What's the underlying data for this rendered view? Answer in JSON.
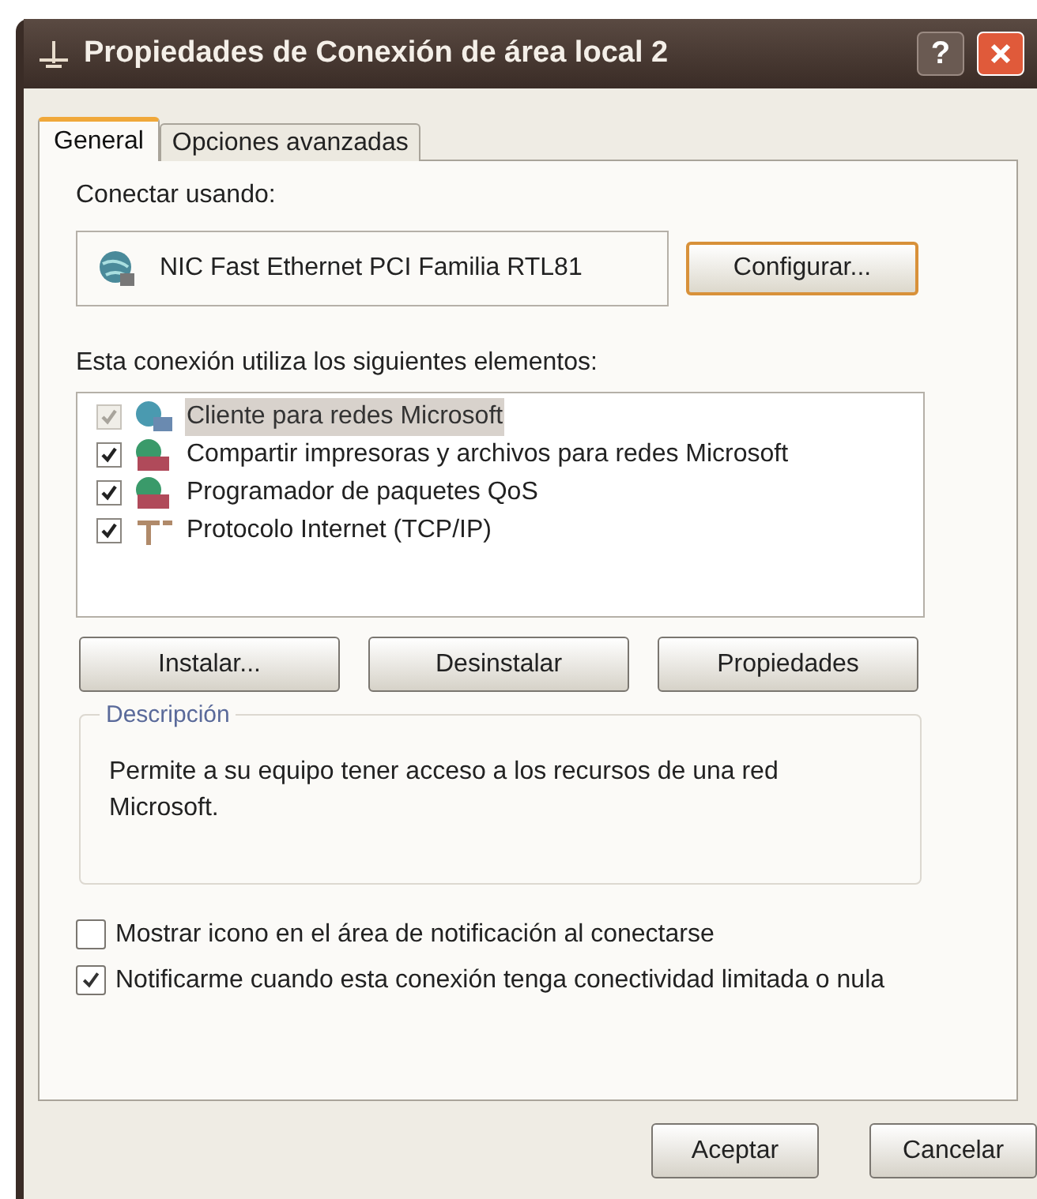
{
  "window": {
    "title": "Propiedades de Conexión de área local 2",
    "help_button": "?"
  },
  "tabs": [
    {
      "label": "General",
      "selected": true
    },
    {
      "label": "Opciones avanzadas",
      "selected": false
    }
  ],
  "connect_using": {
    "label": "Conectar usando:",
    "adapter": "NIC Fast Ethernet PCI Familia RTL81",
    "configure_button": "Configurar..."
  },
  "components": {
    "label": "Esta conexión utiliza los siguientes elementos:",
    "items": [
      {
        "kind": "client",
        "label": "Cliente para redes Microsoft",
        "checked": true,
        "disabled": true,
        "selected": true
      },
      {
        "kind": "share",
        "label": "Compartir impresoras y archivos para redes Microsoft",
        "checked": true,
        "disabled": false,
        "selected": false
      },
      {
        "kind": "share",
        "label": "Programador de paquetes QoS",
        "checked": true,
        "disabled": false,
        "selected": false
      },
      {
        "kind": "protocol",
        "label": "Protocolo Internet (TCP/IP)",
        "checked": true,
        "disabled": false,
        "selected": false
      }
    ]
  },
  "component_buttons": [
    "Instalar...",
    "Desinstalar",
    "Propiedades"
  ],
  "description": {
    "legend": "Descripción",
    "text": "Permite a su equipo tener acceso a los recursos de una red Microsoft."
  },
  "options": [
    {
      "label": "Mostrar icono en el área de notificación al conectarse",
      "checked": false
    },
    {
      "label": "Notificarme cuando esta conexión tenga conectividad limitada o nula",
      "checked": true
    }
  ],
  "buttons": [
    "Aceptar",
    "Cancelar"
  ]
}
